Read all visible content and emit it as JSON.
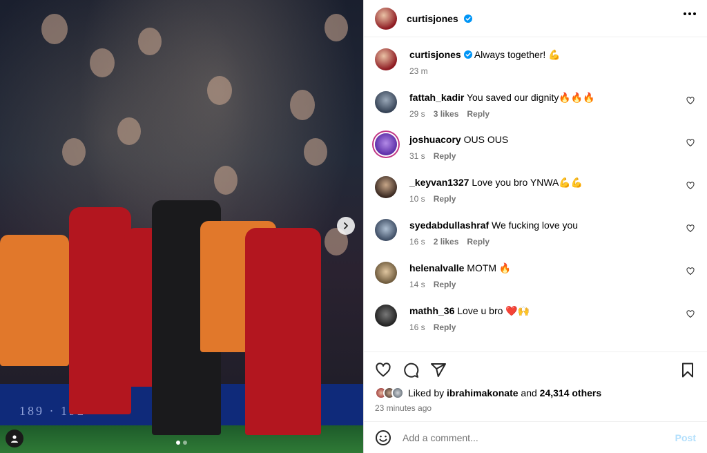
{
  "header": {
    "username": "curtisjones",
    "verified": true,
    "more_icon": "more-horizontal-icon"
  },
  "media": {
    "hoarding_text": "189 · 192",
    "carousel": {
      "count": 2,
      "active": 0
    },
    "next_icon": "chevron-right-icon",
    "tag_icon": "user-tag-icon"
  },
  "caption": {
    "username": "curtisjones",
    "text": "Always together! 💪",
    "time": "23 m"
  },
  "comments": [
    {
      "username": "fattah_kadir",
      "text": "You saved our dignity🔥🔥🔥",
      "time": "29 s",
      "likes": "3 likes",
      "reply": "Reply"
    },
    {
      "username": "joshuacory",
      "text": "OUS OUS",
      "time": "31 s",
      "likes": "",
      "reply": "Reply"
    },
    {
      "username": "_keyvan1327",
      "text": "Love you bro YNWA💪💪",
      "time": "10 s",
      "likes": "",
      "reply": "Reply"
    },
    {
      "username": "syedabdullashraf",
      "text": "We fucking love you",
      "time": "16 s",
      "likes": "2 likes",
      "reply": "Reply"
    },
    {
      "username": "helenalvalle",
      "text": "MOTM 🔥",
      "time": "14 s",
      "likes": "",
      "reply": "Reply"
    },
    {
      "username": "mathh_36",
      "text": "Love u bro ❤️🙌",
      "time": "16 s",
      "likes": "",
      "reply": "Reply"
    }
  ],
  "likes": {
    "prefix": "Liked by",
    "user": "ibrahimakonate",
    "connector": "and",
    "others": "24,314 others"
  },
  "posted": "23 minutes ago",
  "comment_box": {
    "placeholder": "Add a comment...",
    "post_label": "Post"
  },
  "colors": {
    "verified": "#0095f6",
    "muted": "#737373",
    "post_disabled": "#b2dffc"
  }
}
